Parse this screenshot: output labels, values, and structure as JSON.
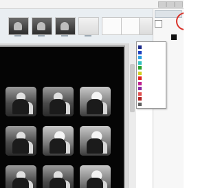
{
  "window": {
    "controls": [
      "minimize-icon",
      "maximize-icon",
      "close-icon"
    ]
  },
  "filmstrip": {
    "thumbnails": [
      {
        "kind": "photo"
      },
      {
        "kind": "photo"
      },
      {
        "kind": "photo"
      },
      {
        "kind": "photo"
      },
      {
        "kind": "blank"
      },
      {
        "kind": "blank"
      },
      {
        "kind": "blank"
      }
    ]
  },
  "right_panel": {
    "title": "",
    "highlight_color": "#d9342b"
  },
  "color_list": {
    "items": [
      {
        "color": "#1a2a8a"
      },
      {
        "color": "#1b3fbf"
      },
      {
        "color": "#2aa0e0"
      },
      {
        "color": "#30c0c0"
      },
      {
        "color": "#2aa02a"
      },
      {
        "color": "#d0d020"
      },
      {
        "color": "#e02020"
      },
      {
        "color": "#c02090"
      },
      {
        "color": "#8a2aa0"
      },
      {
        "color": "#e05050"
      },
      {
        "color": "#b02020"
      },
      {
        "color": "#606060"
      }
    ]
  },
  "contact_sheet": {
    "background": "#050505",
    "photos": [
      {
        "style": "dark"
      },
      {
        "style": "dark"
      },
      {
        "style": "light"
      },
      {
        "style": "dark"
      },
      {
        "style": "light"
      },
      {
        "style": "light"
      },
      {
        "style": "dark"
      },
      {
        "style": "dark"
      },
      {
        "style": "light"
      }
    ]
  }
}
